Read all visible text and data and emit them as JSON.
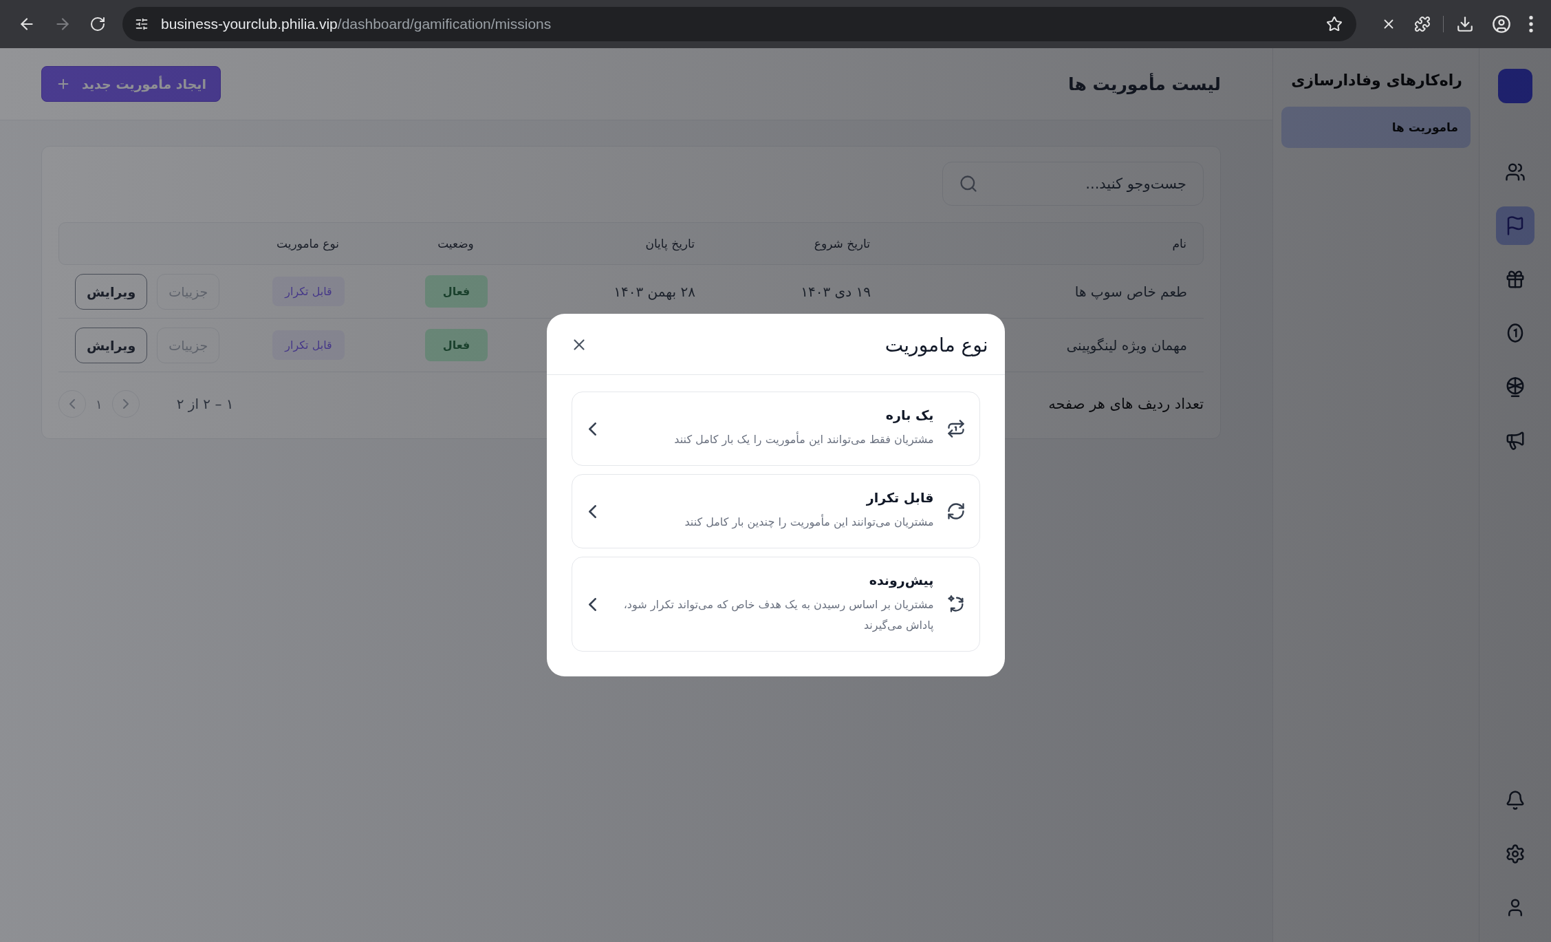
{
  "browser": {
    "url_host": "business-yourclub.philia.vip",
    "url_path": "/dashboard/gamification/missions"
  },
  "rail": {
    "items": [
      {
        "kind": "users",
        "selected": false
      },
      {
        "kind": "flag",
        "selected": true
      },
      {
        "kind": "gift",
        "selected": false
      },
      {
        "kind": "coin",
        "selected": false
      },
      {
        "kind": "wheel",
        "selected": false
      },
      {
        "kind": "megaphone",
        "selected": false
      }
    ],
    "bottom": [
      {
        "kind": "bell"
      },
      {
        "kind": "settings"
      },
      {
        "kind": "user"
      }
    ]
  },
  "sidebar": {
    "title": "راه‌کارهای وفادارسازی",
    "items": [
      {
        "label": "ماموریت ها",
        "selected": true
      }
    ]
  },
  "header": {
    "title": "لیست مأموریت ها",
    "create_button": "ایجاد مأموریت جدید"
  },
  "search": {
    "placeholder": "جست‌وجو کنید..."
  },
  "table": {
    "columns": [
      "نام",
      "تاریخ شروع",
      "تاریخ پایان",
      "وضعیت",
      "نوع ماموریت"
    ],
    "rows": [
      {
        "name": "طعم خاص سوپ ها",
        "start": "۱۹ دی ۱۴۰۳",
        "end": "۲۸ بهمن ۱۴۰۳",
        "status": "فعال",
        "type": "قابل تکرار",
        "actions": [
          "جزییات",
          "ویرایش"
        ]
      },
      {
        "name": "مهمان ویژه لینگوپینی",
        "status": "فعال",
        "type": "قابل تکرار",
        "actions": [
          "جزییات",
          "ویرایش"
        ]
      }
    ]
  },
  "pagination": {
    "rows_per_page_label": "تعداد ردیف های هر صفحه",
    "range": "۱ – ۲ از ۲",
    "page": "۱"
  },
  "modal": {
    "title": "نوع ماموریت",
    "options": [
      {
        "kind": "once",
        "title": "یک باره",
        "description": "مشتریان فقط می‌توانند این مأموریت را یک بار کامل کنند"
      },
      {
        "kind": "repeatable",
        "title": "قابل تکرار",
        "description": "مشتریان می‌توانند این مأموریت را چندین بار کامل کنند"
      },
      {
        "kind": "progressive",
        "title": "پیش‌رونده",
        "description": "مشتریان بر اساس رسیدن به یک هدف خاص که می‌تواند تکرار شود، پاداش می‌گیرند"
      }
    ]
  }
}
